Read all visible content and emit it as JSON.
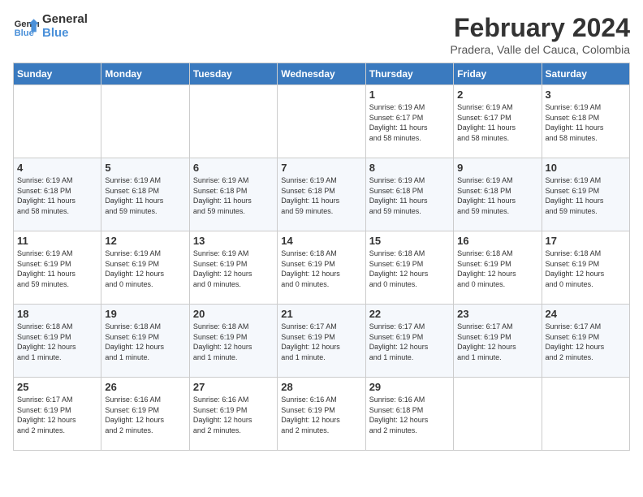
{
  "logo": {
    "line1": "General",
    "line2": "Blue"
  },
  "title": "February 2024",
  "subtitle": "Pradera, Valle del Cauca, Colombia",
  "days_of_week": [
    "Sunday",
    "Monday",
    "Tuesday",
    "Wednesday",
    "Thursday",
    "Friday",
    "Saturday"
  ],
  "weeks": [
    [
      {
        "day": "",
        "info": ""
      },
      {
        "day": "",
        "info": ""
      },
      {
        "day": "",
        "info": ""
      },
      {
        "day": "",
        "info": ""
      },
      {
        "day": "1",
        "info": "Sunrise: 6:19 AM\nSunset: 6:17 PM\nDaylight: 11 hours\nand 58 minutes."
      },
      {
        "day": "2",
        "info": "Sunrise: 6:19 AM\nSunset: 6:17 PM\nDaylight: 11 hours\nand 58 minutes."
      },
      {
        "day": "3",
        "info": "Sunrise: 6:19 AM\nSunset: 6:18 PM\nDaylight: 11 hours\nand 58 minutes."
      }
    ],
    [
      {
        "day": "4",
        "info": "Sunrise: 6:19 AM\nSunset: 6:18 PM\nDaylight: 11 hours\nand 58 minutes."
      },
      {
        "day": "5",
        "info": "Sunrise: 6:19 AM\nSunset: 6:18 PM\nDaylight: 11 hours\nand 59 minutes."
      },
      {
        "day": "6",
        "info": "Sunrise: 6:19 AM\nSunset: 6:18 PM\nDaylight: 11 hours\nand 59 minutes."
      },
      {
        "day": "7",
        "info": "Sunrise: 6:19 AM\nSunset: 6:18 PM\nDaylight: 11 hours\nand 59 minutes."
      },
      {
        "day": "8",
        "info": "Sunrise: 6:19 AM\nSunset: 6:18 PM\nDaylight: 11 hours\nand 59 minutes."
      },
      {
        "day": "9",
        "info": "Sunrise: 6:19 AM\nSunset: 6:18 PM\nDaylight: 11 hours\nand 59 minutes."
      },
      {
        "day": "10",
        "info": "Sunrise: 6:19 AM\nSunset: 6:19 PM\nDaylight: 11 hours\nand 59 minutes."
      }
    ],
    [
      {
        "day": "11",
        "info": "Sunrise: 6:19 AM\nSunset: 6:19 PM\nDaylight: 11 hours\nand 59 minutes."
      },
      {
        "day": "12",
        "info": "Sunrise: 6:19 AM\nSunset: 6:19 PM\nDaylight: 12 hours\nand 0 minutes."
      },
      {
        "day": "13",
        "info": "Sunrise: 6:19 AM\nSunset: 6:19 PM\nDaylight: 12 hours\nand 0 minutes."
      },
      {
        "day": "14",
        "info": "Sunrise: 6:18 AM\nSunset: 6:19 PM\nDaylight: 12 hours\nand 0 minutes."
      },
      {
        "day": "15",
        "info": "Sunrise: 6:18 AM\nSunset: 6:19 PM\nDaylight: 12 hours\nand 0 minutes."
      },
      {
        "day": "16",
        "info": "Sunrise: 6:18 AM\nSunset: 6:19 PM\nDaylight: 12 hours\nand 0 minutes."
      },
      {
        "day": "17",
        "info": "Sunrise: 6:18 AM\nSunset: 6:19 PM\nDaylight: 12 hours\nand 0 minutes."
      }
    ],
    [
      {
        "day": "18",
        "info": "Sunrise: 6:18 AM\nSunset: 6:19 PM\nDaylight: 12 hours\nand 1 minute."
      },
      {
        "day": "19",
        "info": "Sunrise: 6:18 AM\nSunset: 6:19 PM\nDaylight: 12 hours\nand 1 minute."
      },
      {
        "day": "20",
        "info": "Sunrise: 6:18 AM\nSunset: 6:19 PM\nDaylight: 12 hours\nand 1 minute."
      },
      {
        "day": "21",
        "info": "Sunrise: 6:17 AM\nSunset: 6:19 PM\nDaylight: 12 hours\nand 1 minute."
      },
      {
        "day": "22",
        "info": "Sunrise: 6:17 AM\nSunset: 6:19 PM\nDaylight: 12 hours\nand 1 minute."
      },
      {
        "day": "23",
        "info": "Sunrise: 6:17 AM\nSunset: 6:19 PM\nDaylight: 12 hours\nand 1 minute."
      },
      {
        "day": "24",
        "info": "Sunrise: 6:17 AM\nSunset: 6:19 PM\nDaylight: 12 hours\nand 2 minutes."
      }
    ],
    [
      {
        "day": "25",
        "info": "Sunrise: 6:17 AM\nSunset: 6:19 PM\nDaylight: 12 hours\nand 2 minutes."
      },
      {
        "day": "26",
        "info": "Sunrise: 6:16 AM\nSunset: 6:19 PM\nDaylight: 12 hours\nand 2 minutes."
      },
      {
        "day": "27",
        "info": "Sunrise: 6:16 AM\nSunset: 6:19 PM\nDaylight: 12 hours\nand 2 minutes."
      },
      {
        "day": "28",
        "info": "Sunrise: 6:16 AM\nSunset: 6:19 PM\nDaylight: 12 hours\nand 2 minutes."
      },
      {
        "day": "29",
        "info": "Sunrise: 6:16 AM\nSunset: 6:18 PM\nDaylight: 12 hours\nand 2 minutes."
      },
      {
        "day": "",
        "info": ""
      },
      {
        "day": "",
        "info": ""
      }
    ]
  ]
}
